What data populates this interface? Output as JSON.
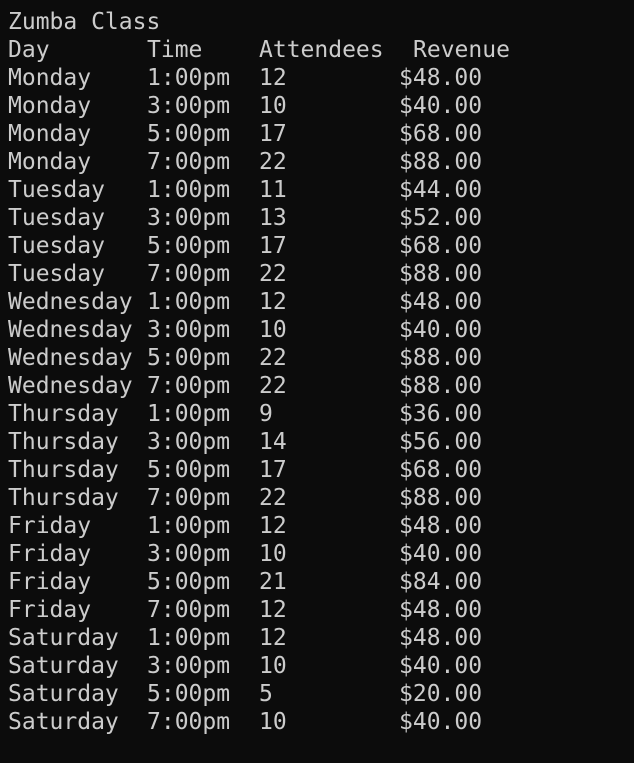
{
  "title": "Zumba Class",
  "headers": {
    "day": "Day",
    "time": "Time",
    "attendees": "Attendees",
    "revenue": "Revenue"
  },
  "rows": [
    {
      "day": "Monday",
      "time": "1:00pm",
      "attendees": "12",
      "revenue": "$48.00"
    },
    {
      "day": "Monday",
      "time": "3:00pm",
      "attendees": "10",
      "revenue": "$40.00"
    },
    {
      "day": "Monday",
      "time": "5:00pm",
      "attendees": "17",
      "revenue": "$68.00"
    },
    {
      "day": "Monday",
      "time": "7:00pm",
      "attendees": "22",
      "revenue": "$88.00"
    },
    {
      "day": "Tuesday",
      "time": "1:00pm",
      "attendees": "11",
      "revenue": "$44.00"
    },
    {
      "day": "Tuesday",
      "time": "3:00pm",
      "attendees": "13",
      "revenue": "$52.00"
    },
    {
      "day": "Tuesday",
      "time": "5:00pm",
      "attendees": "17",
      "revenue": "$68.00"
    },
    {
      "day": "Tuesday",
      "time": "7:00pm",
      "attendees": "22",
      "revenue": "$88.00"
    },
    {
      "day": "Wednesday",
      "time": "1:00pm",
      "attendees": "12",
      "revenue": "$48.00"
    },
    {
      "day": "Wednesday",
      "time": "3:00pm",
      "attendees": "10",
      "revenue": "$40.00"
    },
    {
      "day": "Wednesday",
      "time": "5:00pm",
      "attendees": "22",
      "revenue": "$88.00"
    },
    {
      "day": "Wednesday",
      "time": "7:00pm",
      "attendees": "22",
      "revenue": "$88.00"
    },
    {
      "day": "Thursday",
      "time": "1:00pm",
      "attendees": "9",
      "revenue": "$36.00"
    },
    {
      "day": "Thursday",
      "time": "3:00pm",
      "attendees": "14",
      "revenue": "$56.00"
    },
    {
      "day": "Thursday",
      "time": "5:00pm",
      "attendees": "17",
      "revenue": "$68.00"
    },
    {
      "day": "Thursday",
      "time": "7:00pm",
      "attendees": "22",
      "revenue": "$88.00"
    },
    {
      "day": "Friday",
      "time": "1:00pm",
      "attendees": "12",
      "revenue": "$48.00"
    },
    {
      "day": "Friday",
      "time": "3:00pm",
      "attendees": "10",
      "revenue": "$40.00"
    },
    {
      "day": "Friday",
      "time": "5:00pm",
      "attendees": "21",
      "revenue": "$84.00"
    },
    {
      "day": "Friday",
      "time": "7:00pm",
      "attendees": "12",
      "revenue": "$48.00"
    },
    {
      "day": "Saturday",
      "time": "1:00pm",
      "attendees": "12",
      "revenue": "$48.00"
    },
    {
      "day": "Saturday",
      "time": "3:00pm",
      "attendees": "10",
      "revenue": "$40.00"
    },
    {
      "day": "Saturday",
      "time": "5:00pm",
      "attendees": "5",
      "revenue": "$20.00"
    },
    {
      "day": "Saturday",
      "time": "7:00pm",
      "attendees": "10",
      "revenue": "$40.00"
    }
  ],
  "colors": {
    "background": "#0c0c0c",
    "text": "#cccccc"
  }
}
